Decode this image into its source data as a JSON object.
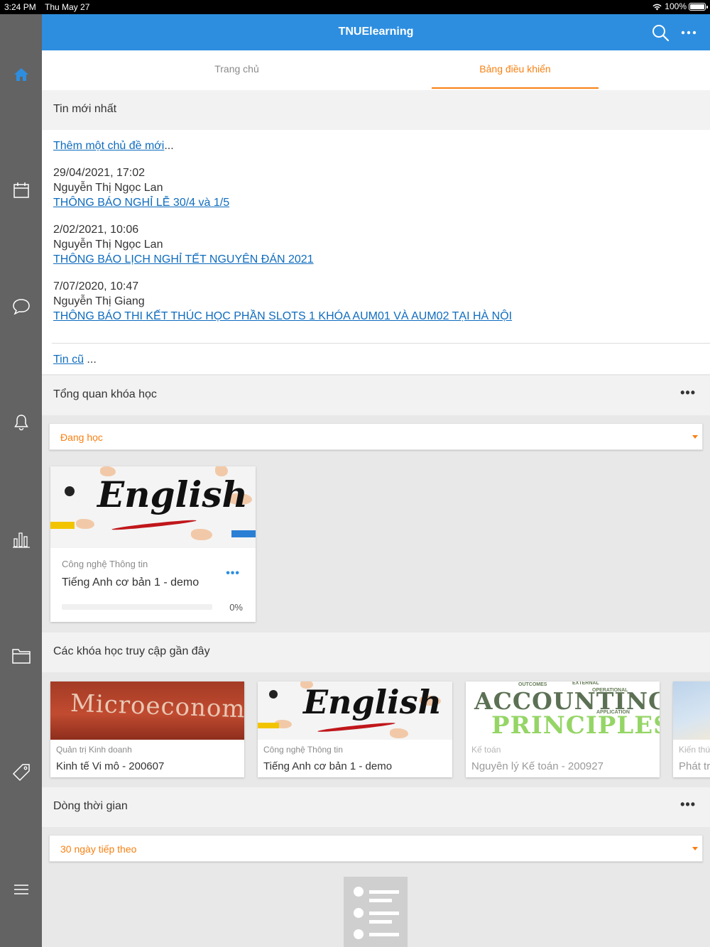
{
  "status": {
    "time": "3:24 PM",
    "date": "Thu May 27",
    "battery": "100%"
  },
  "header": {
    "title": "TNUElearning",
    "search_icon": "search-icon",
    "more_icon": "more-icon"
  },
  "sidebar": {
    "items": [
      "home-icon",
      "calendar-icon",
      "messages-icon",
      "notifications-icon",
      "grades-icon",
      "files-icon",
      "tag-icon",
      "menu-icon"
    ]
  },
  "tabs": [
    {
      "label": "Trang chủ"
    },
    {
      "label": "Bảng điều khiển"
    }
  ],
  "news": {
    "title": "Tin mới nhất",
    "add_link": "Thêm một chủ đề mới",
    "add_suffix": "...",
    "posts": [
      {
        "date": "29/04/2021, 17:02",
        "author": "Nguyễn Thị Ngọc Lan",
        "subject": "THÔNG BÁO NGHỈ LỄ 30/4 và 1/5"
      },
      {
        "date": "2/02/2021, 10:06",
        "author": "Nguyễn Thị Ngọc Lan",
        "subject": "THÔNG BÁO LỊCH NGHỈ TẾT NGUYÊN ĐÁN 2021"
      },
      {
        "date": "7/07/2020, 10:47",
        "author": "Nguyễn Thị Giang",
        "subject": "THÔNG BÁO THI KẾT THÚC HỌC PHẦN SLOTS 1 KHÓA AUM01 VÀ AUM02 TẠI HÀ NỘI"
      }
    ],
    "older_link": "Tin cũ",
    "older_suffix": " ..."
  },
  "overview": {
    "title": "Tổng quan khóa học",
    "filter": "Đang học",
    "course": {
      "category": "Công nghệ Thông tin",
      "name": "Tiếng Anh cơ bản 1 - demo",
      "progress_label": "0%",
      "progress": 0,
      "image_text": "English"
    }
  },
  "recent": {
    "title": "Các khóa học truy cập gần đây",
    "courses": [
      {
        "category": "Quản trị Kinh doanh",
        "name": "Kinh tế Vi mô - 200607",
        "image_text": "Microeconomics"
      },
      {
        "category": "Công nghệ Thông tin",
        "name": "Tiếng Anh cơ bản 1 - demo",
        "image_text": "English"
      },
      {
        "category": "Kế toán",
        "name": "Nguyên lý Kế toán - 200927",
        "image_text_1": "ACCOUNTING",
        "image_text_2": "PRINCIPLES"
      },
      {
        "category": "Kiến thứ",
        "name": "Phát tr"
      }
    ]
  },
  "timeline": {
    "title": "Dòng thời gian",
    "filter": "30 ngày tiếp theo"
  },
  "colors": {
    "header": "#2d8ee0",
    "accent": "#f98012",
    "link": "#0f6cbf",
    "sidebar": "#636363"
  }
}
